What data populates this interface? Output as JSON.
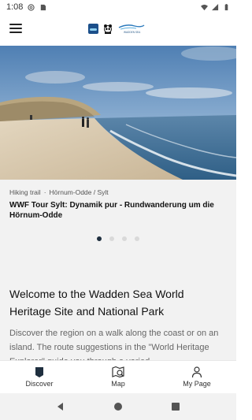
{
  "status_bar": {
    "time": "1:08",
    "icons": [
      "at-sign-icon",
      "sim-card-icon",
      "wifi-icon",
      "signal-icon",
      "battery-icon"
    ]
  },
  "app_bar": {
    "menu_icon": "hamburger-menu-icon",
    "logos": [
      "app-logo",
      "wwf-panda-logo",
      "wadden-sea-logo"
    ],
    "wadden_logo_text": "WADDEN SEA"
  },
  "hero": {
    "image_alt": "beach-dunes-sea-photo"
  },
  "card": {
    "category": "Hiking trail",
    "separator": "·",
    "location": "Hörnum-Odde / Sylt",
    "title": "WWF Tour Sylt: Dynamik pur - Rundwanderung um die Hörnum-Odde"
  },
  "pager": {
    "count": 4,
    "active_index": 0
  },
  "content": {
    "heading": "Welcome to the Wadden Sea World Heritage Site and National Park",
    "body": "Discover the region on a walk along the coast or on an island. The route suggestions in the \"World Heritage Explorer\" guide you through a varied"
  },
  "bottom_nav": {
    "items": [
      {
        "label": "Discover",
        "icon": "discover-icon",
        "active": true
      },
      {
        "label": "Map",
        "icon": "map-icon",
        "active": false
      },
      {
        "label": "My Page",
        "icon": "person-icon",
        "active": false
      }
    ]
  },
  "system_nav": {
    "items": [
      "back-icon",
      "home-icon",
      "recents-icon"
    ]
  },
  "colors": {
    "accent": "#1f2f3f",
    "caption_bg": "#f2f2f2",
    "sea": "#3f6d93",
    "sand": "#d8c9b0"
  }
}
